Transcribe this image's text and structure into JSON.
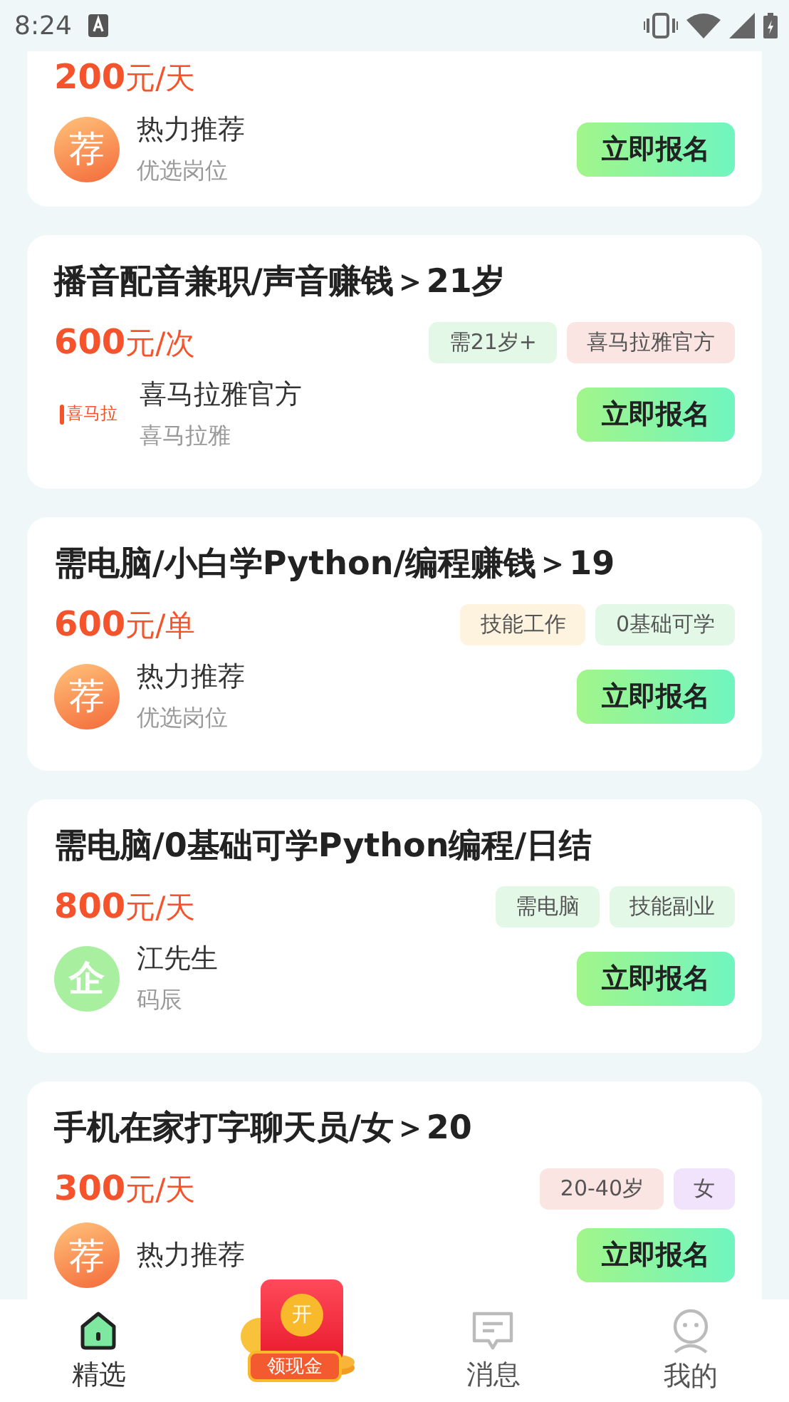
{
  "status_bar": {
    "time": "8:24"
  },
  "jobs": [
    {
      "price": "200",
      "unit": "元/天",
      "poster": {
        "kind": "hot",
        "mark": "荐",
        "name": "热力推荐",
        "subtitle": "优选岗位"
      },
      "button": "立即报名"
    },
    {
      "title": "播音配音兼职/声音赚钱＞21岁",
      "price": "600",
      "unit": "元/次",
      "tags": [
        {
          "label": "需21岁+",
          "color": "#e3f8e6"
        },
        {
          "label": "喜马拉雅官方",
          "color": "#fbe5e3"
        }
      ],
      "poster": {
        "kind": "brand",
        "mark": "喜马拉",
        "name": "喜马拉雅官方",
        "subtitle": "喜马拉雅"
      },
      "button": "立即报名"
    },
    {
      "title": "需电脑/小白学Python/编程赚钱＞19",
      "price": "600",
      "unit": "元/单",
      "tags": [
        {
          "label": "技能工作",
          "color": "#fdf3df"
        },
        {
          "label": "0基础可学",
          "color": "#e3f8e6"
        }
      ],
      "poster": {
        "kind": "hot",
        "mark": "荐",
        "name": "热力推荐",
        "subtitle": "优选岗位"
      },
      "button": "立即报名"
    },
    {
      "title": "需电脑/0基础可学Python编程/日结",
      "price": "800",
      "unit": "元/天",
      "tags": [
        {
          "label": "需电脑",
          "color": "#e3f8e6"
        },
        {
          "label": "技能副业",
          "color": "#e3f8e6"
        }
      ],
      "poster": {
        "kind": "company",
        "mark": "企",
        "name": "江先生",
        "subtitle": "码辰"
      },
      "button": "立即报名"
    },
    {
      "title": "手机在家打字聊天员/女＞20",
      "price": "300",
      "unit": "元/天",
      "tags": [
        {
          "label": "20-40岁",
          "color": "#fbe5e3"
        },
        {
          "label": "女",
          "color": "#f1e3fb"
        }
      ],
      "poster": {
        "kind": "hot",
        "mark": "荐",
        "name": "热力推荐"
      },
      "button": "立即报名"
    }
  ],
  "nav": [
    {
      "kind": "home",
      "label": "精选",
      "selected": true
    },
    {
      "kind": "reward",
      "label": "领现金",
      "badge": "开",
      "selected": false
    },
    {
      "kind": "message",
      "label": "消息",
      "selected": false
    },
    {
      "kind": "profile",
      "label": "我的",
      "selected": false
    }
  ]
}
